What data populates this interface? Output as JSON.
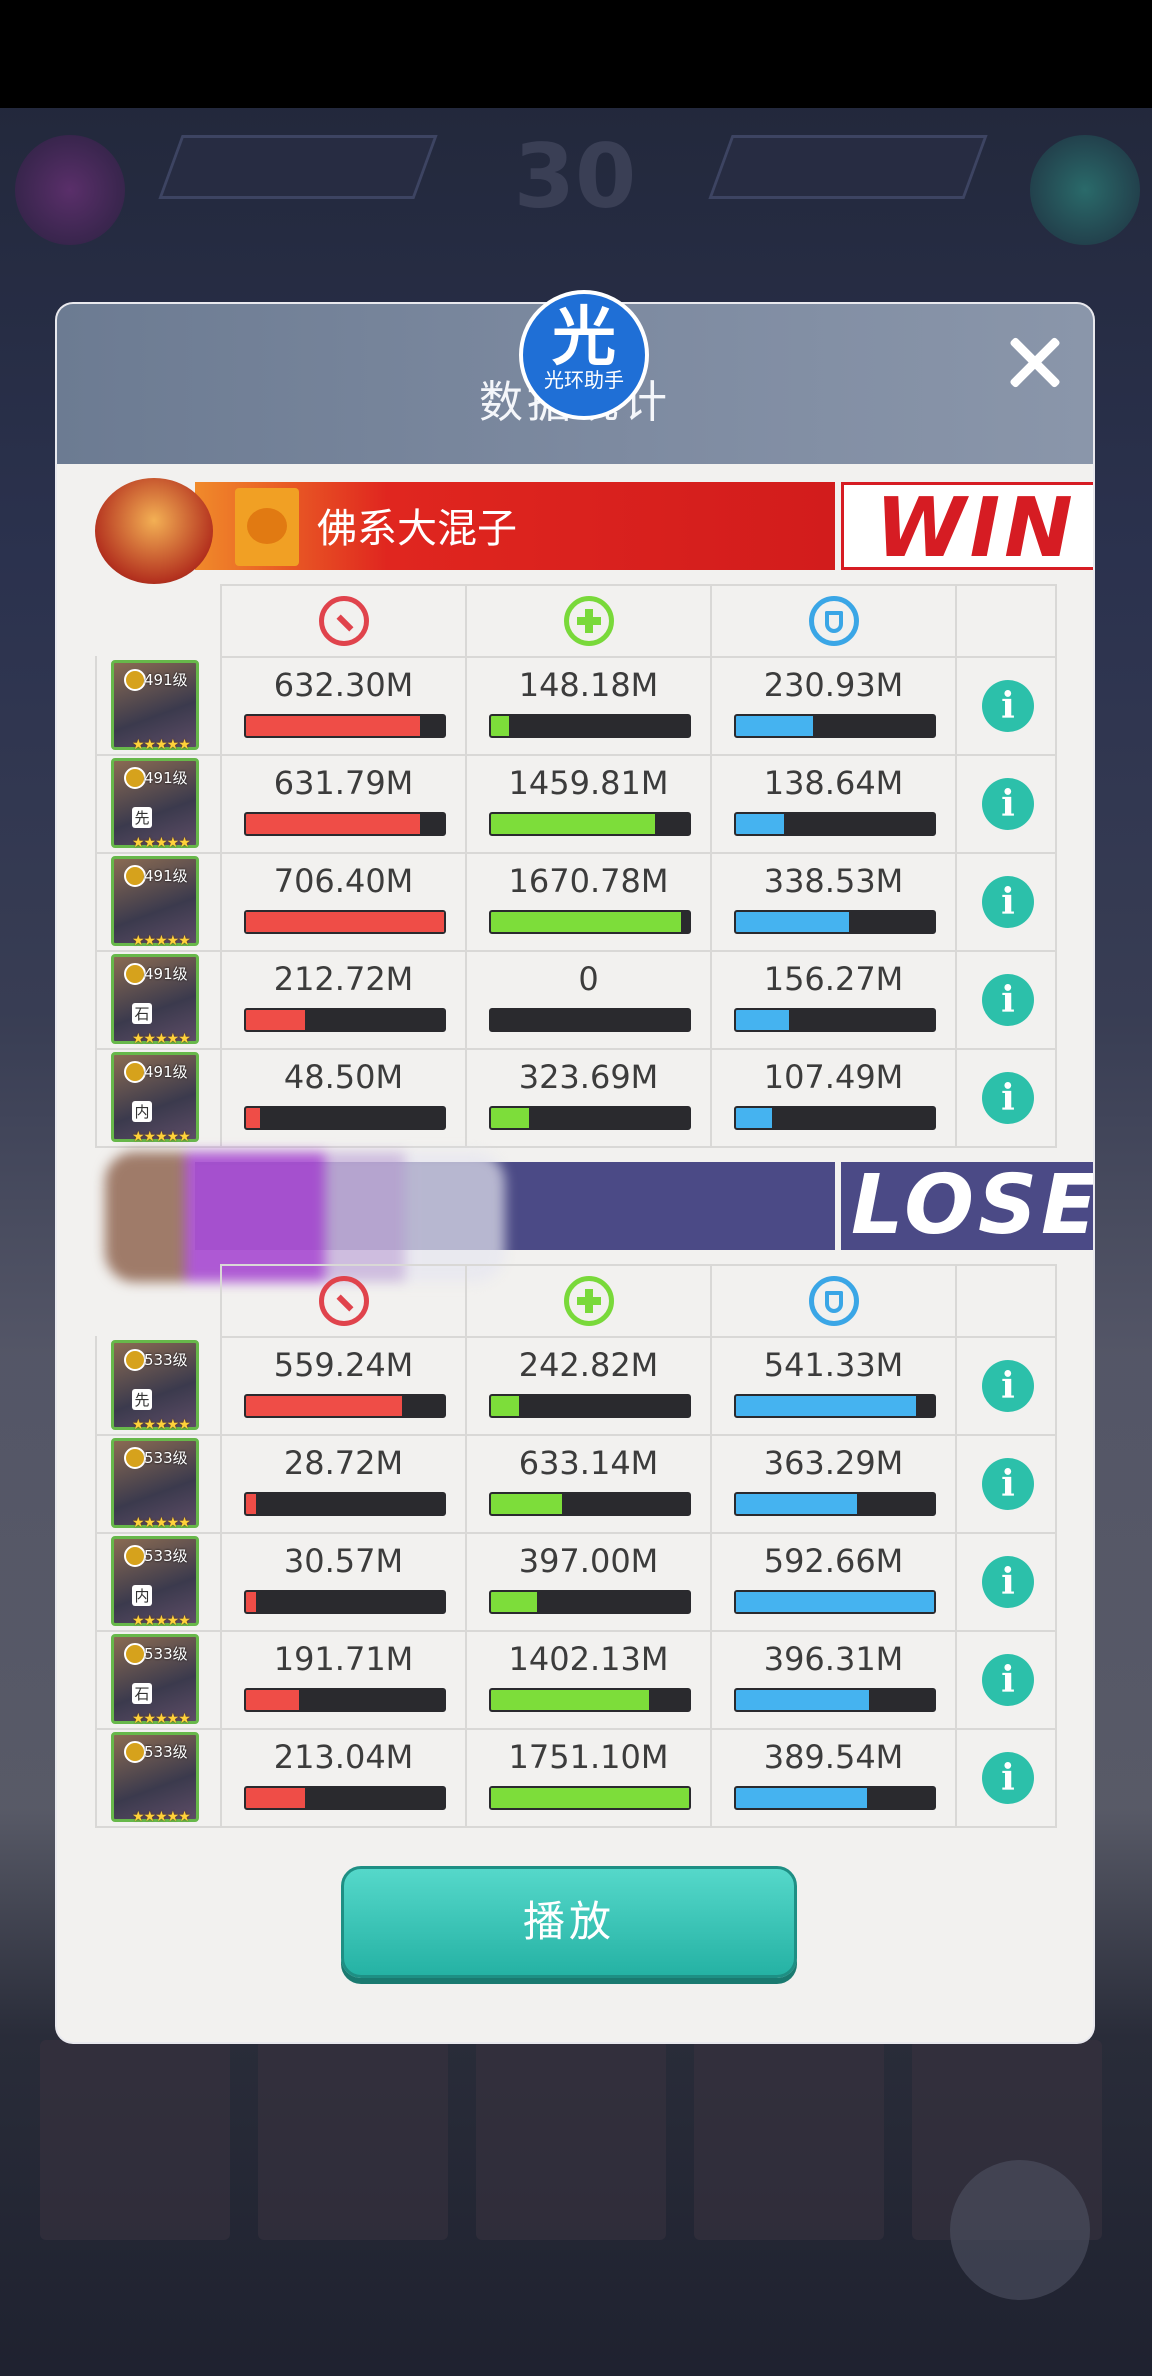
{
  "dialog": {
    "title": "数据统计",
    "close_label": "",
    "play_label": "播放"
  },
  "watermark": {
    "main": "光",
    "sub": "光环助手"
  },
  "background": {
    "score": "30"
  },
  "team_win": {
    "name": "佛系大混子",
    "result": "WIN",
    "heroes": [
      {
        "level": "491级",
        "tag": "",
        "atk": "632.30M",
        "heal": "148.18M",
        "def": "230.93M",
        "atk_pct": 0.88,
        "heal_pct": 0.09,
        "def_pct": 0.39
      },
      {
        "level": "491级",
        "tag": "先",
        "atk": "631.79M",
        "heal": "1459.81M",
        "def": "138.64M",
        "atk_pct": 0.88,
        "heal_pct": 0.83,
        "def_pct": 0.24
      },
      {
        "level": "491级",
        "tag": "",
        "atk": "706.40M",
        "heal": "1670.78M",
        "def": "338.53M",
        "atk_pct": 1.0,
        "heal_pct": 0.96,
        "def_pct": 0.57
      },
      {
        "level": "491级",
        "tag": "石",
        "atk": "212.72M",
        "heal": "0",
        "def": "156.27M",
        "atk_pct": 0.3,
        "heal_pct": 0.0,
        "def_pct": 0.27
      },
      {
        "level": "491级",
        "tag": "内",
        "atk": "48.50M",
        "heal": "323.69M",
        "def": "107.49M",
        "atk_pct": 0.07,
        "heal_pct": 0.19,
        "def_pct": 0.18
      }
    ]
  },
  "team_lose": {
    "name": "",
    "result": "LOSE",
    "heroes": [
      {
        "level": "533级",
        "tag": "先",
        "atk": "559.24M",
        "heal": "242.82M",
        "def": "541.33M",
        "atk_pct": 0.79,
        "heal_pct": 0.14,
        "def_pct": 0.91
      },
      {
        "level": "533级",
        "tag": "",
        "atk": "28.72M",
        "heal": "633.14M",
        "def": "363.29M",
        "atk_pct": 0.05,
        "heal_pct": 0.36,
        "def_pct": 0.61
      },
      {
        "level": "533级",
        "tag": "内",
        "atk": "30.57M",
        "heal": "397.00M",
        "def": "592.66M",
        "atk_pct": 0.05,
        "heal_pct": 0.23,
        "def_pct": 1.0
      },
      {
        "level": "533级",
        "tag": "石",
        "atk": "191.71M",
        "heal": "1402.13M",
        "def": "396.31M",
        "atk_pct": 0.27,
        "heal_pct": 0.8,
        "def_pct": 0.67
      },
      {
        "level": "533级",
        "tag": "",
        "atk": "213.04M",
        "heal": "1751.10M",
        "def": "389.54M",
        "atk_pct": 0.3,
        "heal_pct": 1.0,
        "def_pct": 0.66
      }
    ]
  },
  "icons": {
    "attack": "sword-icon",
    "heal": "heal-cross-icon",
    "defense": "shield-icon",
    "info": "info-icon"
  },
  "colors": {
    "attack": "#ef4d47",
    "heal": "#7ddd3a",
    "defense": "#45b3f0",
    "win": "#d61c23",
    "lose": "#4b4a86",
    "accent": "#2cc0aa"
  },
  "info_glyph": "i",
  "stars": "★★★★★"
}
